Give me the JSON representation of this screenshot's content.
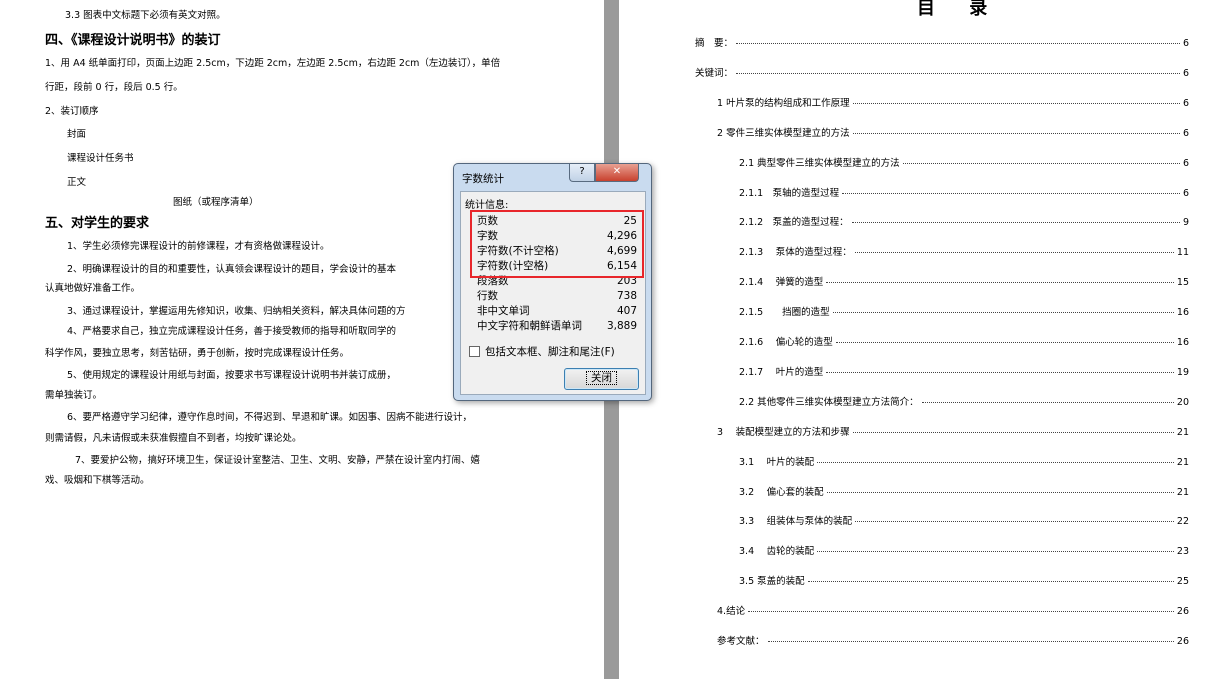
{
  "left_page": {
    "lines": [
      "3.3 图表中文标题下必须有英文对照。",
      "四、《课程设计说明书》的装订",
      "1、用 A4 纸单面打印，页面上边距 2.5cm，下边距 2cm，左边距 2.5cm，右边距 2cm（左边装订），单倍",
      "行距，段前 0 行，段后 0.5 行。",
      "2、装订顺序",
      "封面",
      "课程设计任务书",
      "正文",
      "图纸（或程序清单）",
      "五、对学生的要求",
      "1、学生必须修完课程设计的前修课程，才有资格做课程设计。",
      "2、明确课程设计的目的和重要性，认真领会课程设计的题目，学会设计的基本",
      "认真地做好准备工作。",
      "3、通过课程设计，掌握运用先修知识，收集、归纳相关资料，解决具体问题的方",
      "4、严格要求自己，独立完成课程设计任务，善于接受教师的指导和听取同学的",
      "科学作风，要独立思考，刻苦钻研，勇于创新，按时完成课程设计任务。",
      "5、使用规定的课程设计用纸与封面，按要求书写课程设计说明书并装订成册，",
      "需单独装订。",
      "6、要严格遵守学习纪律，遵守作息时间，不得迟到、早退和旷课。如因事、因病不能进行设计，",
      "则需请假，凡未请假或未获准假擅自不到者，均按旷课论处。",
      "7、要爱护公物，搞好环境卫生，保证设计室整洁、卫生、文明、安静，严禁在设计室内打闹、嬉",
      "戏、吸烟和下棋等活动。"
    ]
  },
  "right_page": {
    "title": "目 录",
    "toc": [
      {
        "label": "摘　要：",
        "page": "6"
      },
      {
        "label": "关键词：",
        "page": "6"
      },
      {
        "label": "1 叶片泵的结构组成和工作原理",
        "page": "6"
      },
      {
        "label": "2 零件三维实体模型建立的方法",
        "page": "6"
      },
      {
        "label": "2.1 典型零件三维实体模型建立的方法",
        "page": "6"
      },
      {
        "label": "2.1.1　泵轴的造型过程",
        "page": "6"
      },
      {
        "label": "2.1.2　泵盖的造型过程：",
        "page": "9"
      },
      {
        "label": "2.1.3　 泵体的造型过程：",
        "page": "11"
      },
      {
        "label": "2.1.4　 弹簧的造型",
        "page": "15"
      },
      {
        "label": "2.1.5　　挡圈的造型",
        "page": "16"
      },
      {
        "label": "2.1.6　 偏心轮的造型",
        "page": "16"
      },
      {
        "label": "2.1.7　 叶片的造型",
        "page": "19"
      },
      {
        "label": "2.2 其他零件三维实体模型建立方法简介：",
        "page": "20"
      },
      {
        "label": "3　 装配模型建立的方法和步骤",
        "page": "21"
      },
      {
        "label": "3.1　 叶片的装配",
        "page": "21"
      },
      {
        "label": "3.2　 偏心套的装配",
        "page": "21"
      },
      {
        "label": "3.3　 组装体与泵体的装配",
        "page": "22"
      },
      {
        "label": "3.4　 齿轮的装配",
        "page": "23"
      },
      {
        "label": "3.5 泵盖的装配",
        "page": "25"
      },
      {
        "label": "4.结论",
        "page": "26"
      },
      {
        "label": "参考文献：",
        "page": "26"
      }
    ]
  },
  "dialog": {
    "title": "字数统计",
    "help_label": "?",
    "close_x_label": "✕",
    "group_label": "统计信息:",
    "stats": [
      {
        "label": "页数",
        "value": "25"
      },
      {
        "label": "字数",
        "value": "4,296"
      },
      {
        "label": "字符数(不计空格)",
        "value": "4,699"
      },
      {
        "label": "字符数(计空格)",
        "value": "6,154"
      },
      {
        "label": "段落数",
        "value": "203"
      },
      {
        "label": "行数",
        "value": "738"
      },
      {
        "label": "非中文单词",
        "value": "407"
      },
      {
        "label": "中文字符和朝鲜语单词",
        "value": "3,889"
      }
    ],
    "checkbox_label": "包括文本框、脚注和尾注(F)",
    "close_button_label": "关闭"
  }
}
